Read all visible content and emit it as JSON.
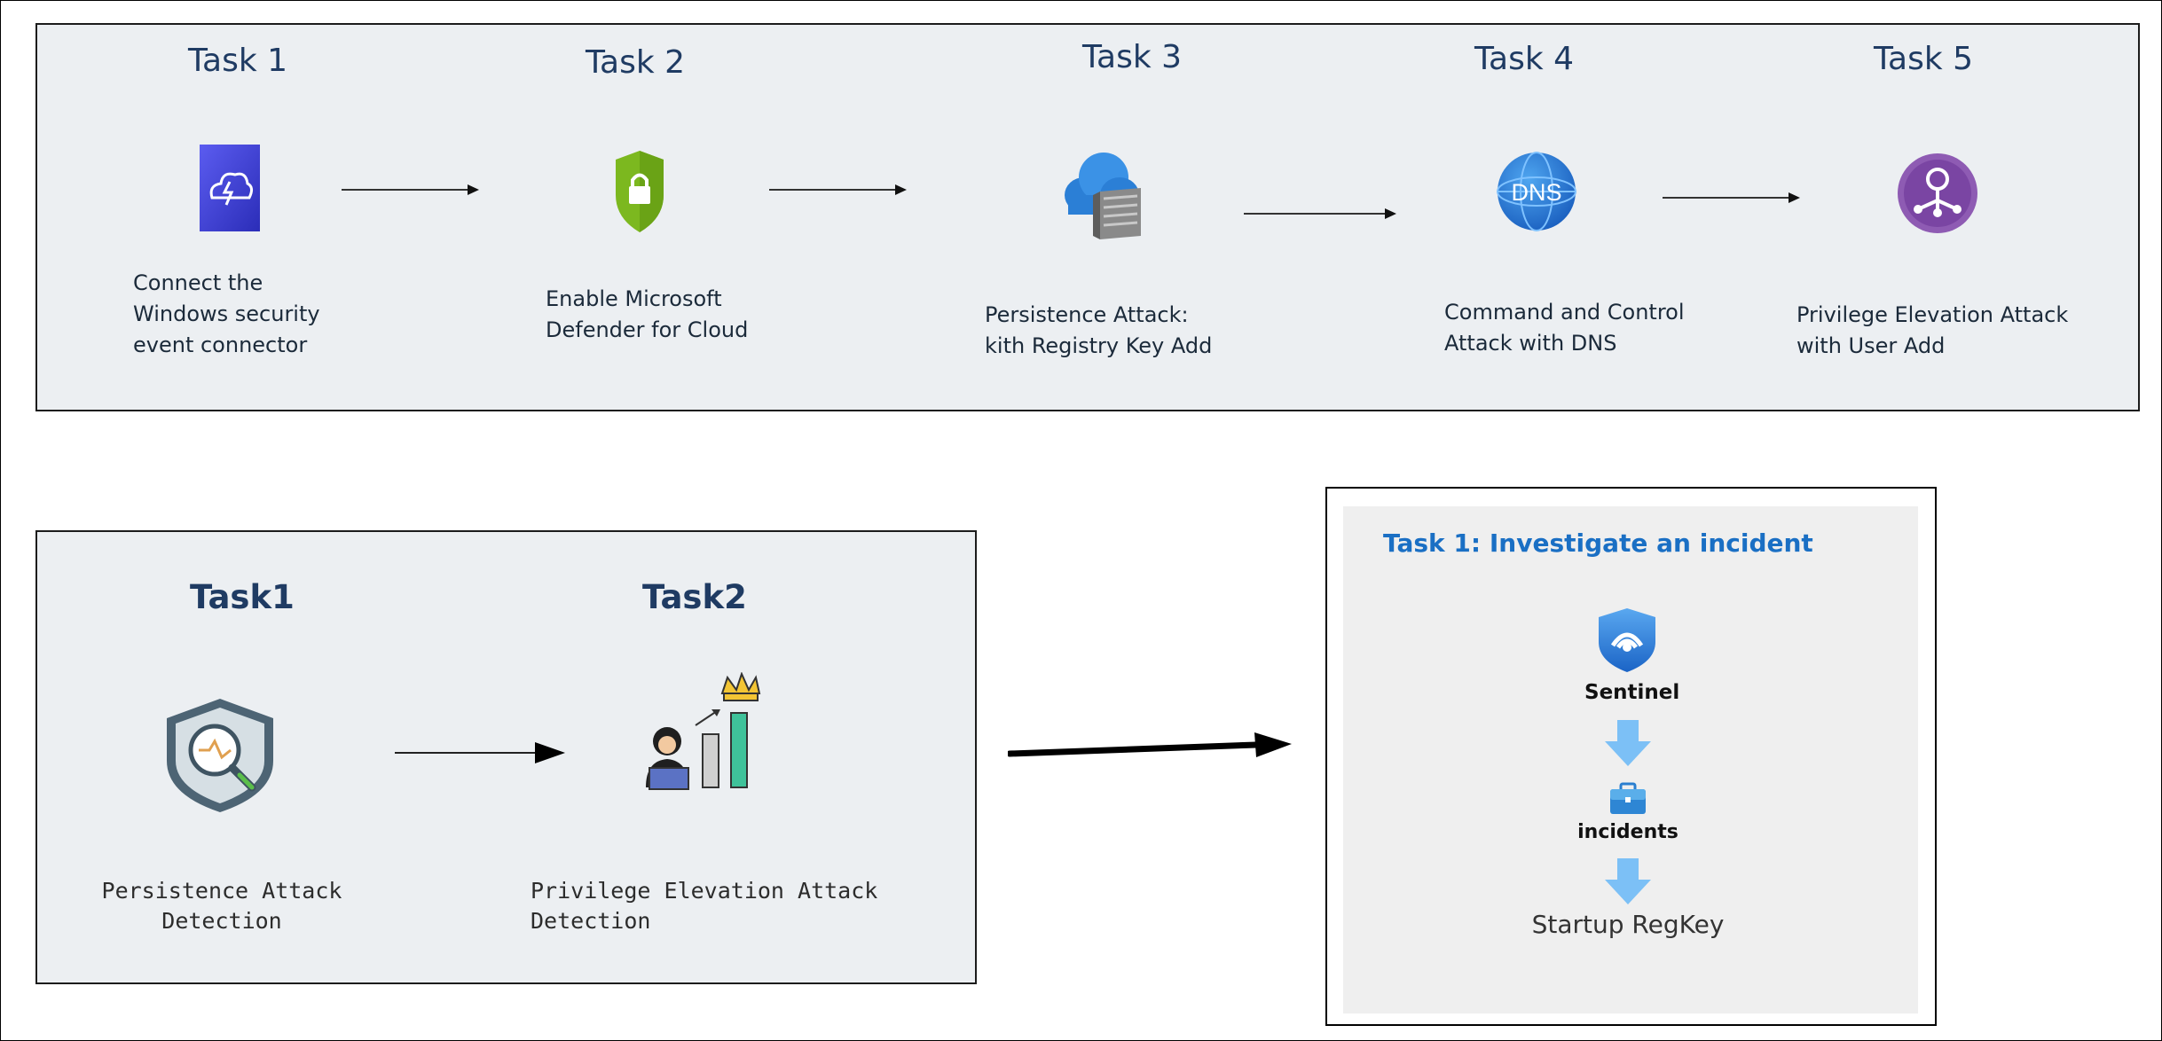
{
  "top_row": {
    "tasks": [
      {
        "title": "Task  1",
        "lines": [
          "Connect the",
          "Windows security",
          "event connector"
        ],
        "icon": "cloud-lightning-icon"
      },
      {
        "title": "Task  2",
        "lines": [
          "Enable Microsoft",
          "Defender for Cloud"
        ],
        "icon": "shield-lock-icon"
      },
      {
        "title": "Task 3",
        "lines": [
          "Persistence Attack:",
          "kith Registry Key Add"
        ],
        "icon": "cloud-server-icon"
      },
      {
        "title": "Task 4",
        "lines": [
          "Command and Control",
          "Attack with DNS"
        ],
        "icon": "dns-globe-icon"
      },
      {
        "title": "Task 5",
        "lines": [
          "Privilege Elevation Attack",
          "with User Add"
        ],
        "icon": "user-network-icon"
      }
    ]
  },
  "bottom_left": {
    "tasks": [
      {
        "title": "Task1",
        "lines": [
          "Persistence Attack",
          "Detection"
        ],
        "icon": "shield-magnifier-icon"
      },
      {
        "title": "Task2",
        "lines": [
          "Privilege Elevation Attack",
          "Detection"
        ],
        "icon": "user-crown-chart-icon"
      }
    ]
  },
  "investigate": {
    "heading": "Task 1: Investigate an incident",
    "sentinel_label": "Sentinel",
    "incidents_label": "incidents",
    "result_label": "Startup RegKey",
    "heading_color": "#1a6fc4"
  }
}
